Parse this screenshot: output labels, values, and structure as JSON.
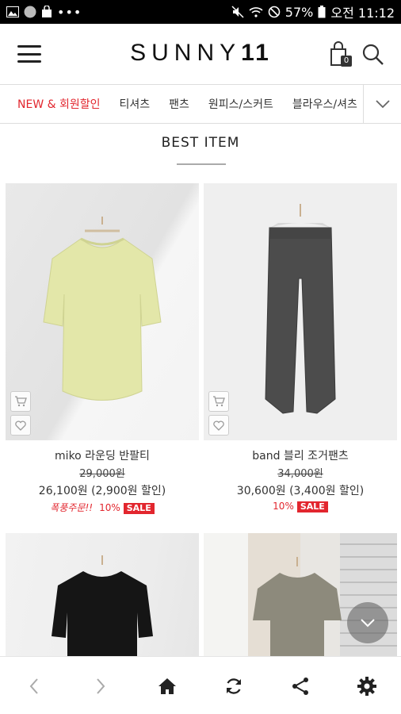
{
  "status_bar": {
    "icons_left": [
      "image-icon",
      "circle-icon",
      "bag-icon",
      "more-dots-icon"
    ],
    "battery": "57%",
    "time": "오전 11:12"
  },
  "header": {
    "logo_text": "SUNNY",
    "logo_bold": "11",
    "cart_count": "0"
  },
  "categories": [
    {
      "label": "NEW & 회원할인",
      "active": true
    },
    {
      "label": "티셔츠",
      "active": false
    },
    {
      "label": "팬츠",
      "active": false
    },
    {
      "label": "원피스/스커트",
      "active": false
    },
    {
      "label": "블라우스/셔츠",
      "active": false
    }
  ],
  "section": {
    "title": "BEST ITEM"
  },
  "products": [
    {
      "name": "miko 라운딩 반팔티",
      "original_price": "29,000원",
      "price": "26,100원 (2,900원 할인)",
      "promo": "폭풍주문!!",
      "discount": "10%",
      "sale": "SALE"
    },
    {
      "name": "band 블리 조거팬츠",
      "original_price": "34,000원",
      "price": "30,600원 (3,400원 할인)",
      "promo": "",
      "discount": "10%",
      "sale": "SALE"
    }
  ],
  "colors": {
    "accent": "#e2262e",
    "text": "#222222"
  }
}
